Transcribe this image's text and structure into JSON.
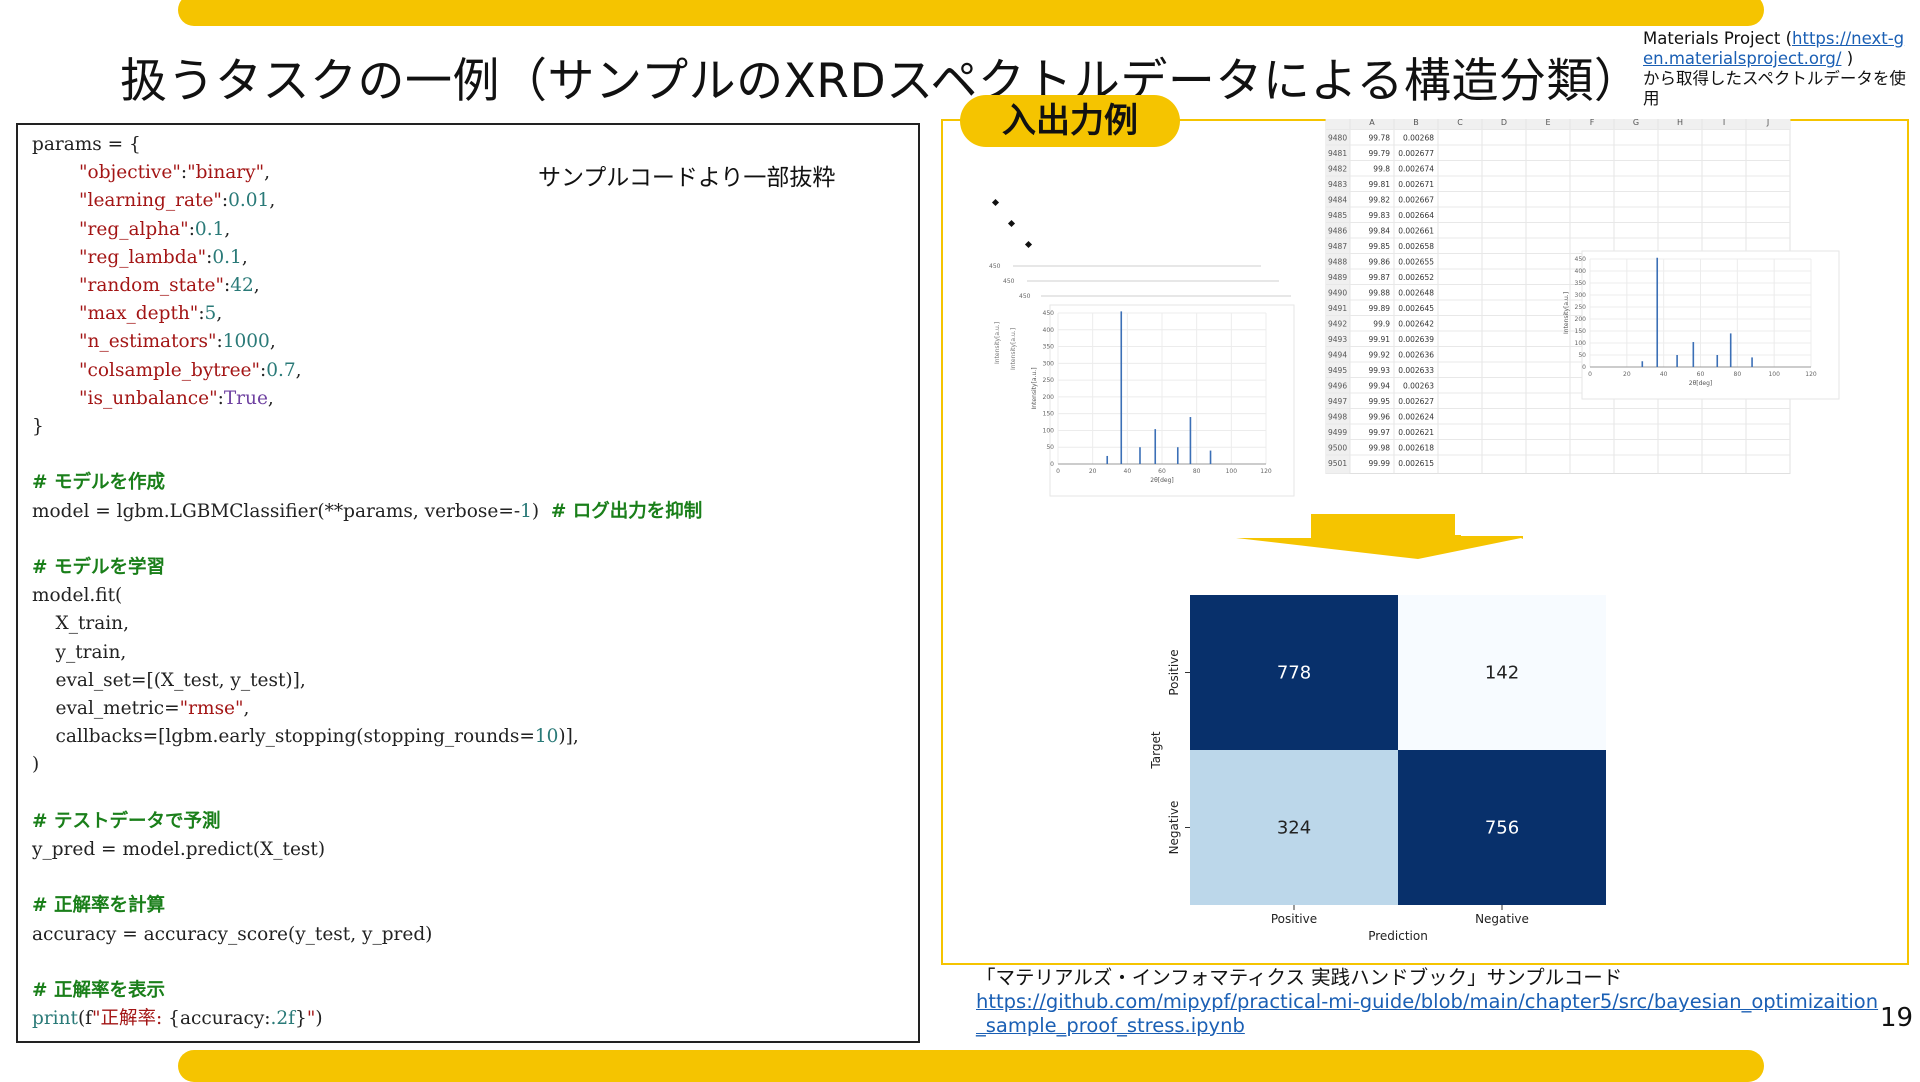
{
  "title": "扱うタスクの一例（サンプルのXRDスペクトルデータによる構造分類）",
  "source": {
    "prefix": "Materials Project (",
    "link": "https://next-gen.materialsproject.org/",
    "suffix": " )",
    "line2": "から取得したスペクトルデータを使用"
  },
  "code": {
    "excerpt_label": "サンプルコードより一部抜粋",
    "params": [
      {
        "key": "objective",
        "value": "\"binary\"",
        "type": "s"
      },
      {
        "key": "learning_rate",
        "value": "0.01",
        "type": "n"
      },
      {
        "key": "reg_alpha",
        "value": "0.1",
        "type": "n"
      },
      {
        "key": "reg_lambda",
        "value": "0.1",
        "type": "n"
      },
      {
        "key": "random_state",
        "value": "42",
        "type": "n"
      },
      {
        "key": "max_depth",
        "value": "5",
        "type": "n"
      },
      {
        "key": "n_estimators",
        "value": "1000",
        "type": "n"
      },
      {
        "key": "colsample_bytree",
        "value": "0.7",
        "type": "n"
      },
      {
        "key": "is_unbalance",
        "value": "True",
        "type": "p"
      }
    ],
    "comment_create": "# モデルを作成",
    "comment_log": "# ログ出力を抑制",
    "comment_train": "# モデルを学習",
    "comment_predict": "# テストデータで予測",
    "comment_acc": "# 正解率を計算",
    "comment_show": "# 正解率を表示",
    "print_label": "正解率: "
  },
  "io": {
    "label": "入出力例",
    "xrd": {
      "y_label": "Intensity[a.u.]",
      "x_label": "2θ[deg]",
      "y_ticks": [
        "0",
        "50",
        "100",
        "150",
        "200",
        "250",
        "300",
        "350",
        "400",
        "450"
      ],
      "x_ticks": [
        "0",
        "20",
        "40",
        "60",
        "80",
        "100",
        "120"
      ],
      "peaks": [
        [
          28.4,
          24
        ],
        [
          36.5,
          455
        ],
        [
          47.3,
          50
        ],
        [
          56.1,
          104
        ],
        [
          69.1,
          50
        ],
        [
          76.4,
          140
        ],
        [
          88.0,
          40
        ]
      ]
    },
    "sheet": {
      "columns": [
        "A",
        "B",
        "C",
        "D",
        "E",
        "F",
        "G",
        "H",
        "I",
        "J"
      ],
      "rows": [
        [
          "9480",
          "99.78",
          "0.00268"
        ],
        [
          "9481",
          "99.79",
          "0.002677"
        ],
        [
          "9482",
          "99.8",
          "0.002674"
        ],
        [
          "9483",
          "99.81",
          "0.002671"
        ],
        [
          "9484",
          "99.82",
          "0.002667"
        ],
        [
          "9485",
          "99.83",
          "0.002664"
        ],
        [
          "9486",
          "99.84",
          "0.002661"
        ],
        [
          "9487",
          "99.85",
          "0.002658"
        ],
        [
          "9488",
          "99.86",
          "0.002655"
        ],
        [
          "9489",
          "99.87",
          "0.002652"
        ],
        [
          "9490",
          "99.88",
          "0.002648"
        ],
        [
          "9491",
          "99.89",
          "0.002645"
        ],
        [
          "9492",
          "99.9",
          "0.002642"
        ],
        [
          "9493",
          "99.91",
          "0.002639"
        ],
        [
          "9494",
          "99.92",
          "0.002636"
        ],
        [
          "9495",
          "99.93",
          "0.002633"
        ],
        [
          "9496",
          "99.94",
          "0.00263"
        ],
        [
          "9497",
          "99.95",
          "0.002627"
        ],
        [
          "9498",
          "99.96",
          "0.002624"
        ],
        [
          "9499",
          "99.97",
          "0.002621"
        ],
        [
          "9500",
          "99.98",
          "0.002618"
        ],
        [
          "9501",
          "99.99",
          "0.002615"
        ]
      ]
    }
  },
  "chart_data": {
    "type": "heatmap",
    "title": "",
    "xlabel": "Prediction",
    "ylabel": "Target",
    "x_categories": [
      "Positive",
      "Negative"
    ],
    "y_categories": [
      "Positive",
      "Negative"
    ],
    "values": [
      [
        778,
        142
      ],
      [
        324,
        756
      ]
    ],
    "colormap": "Blues",
    "colors": {
      "dark": "#08306b",
      "light": "#f7fbff",
      "mid": "#bcd7ea"
    }
  },
  "reference": {
    "title": "「マテリアルズ・インフォマティクス 実践ハンドブック」サンプルコード",
    "link": "https://github.com/mipypf/practical-mi-guide/blob/main/chapter5/src/bayesian_optimizaition_sample_proof_stress.ipynb"
  },
  "page_number": "19",
  "accent_color": "#f5c400"
}
